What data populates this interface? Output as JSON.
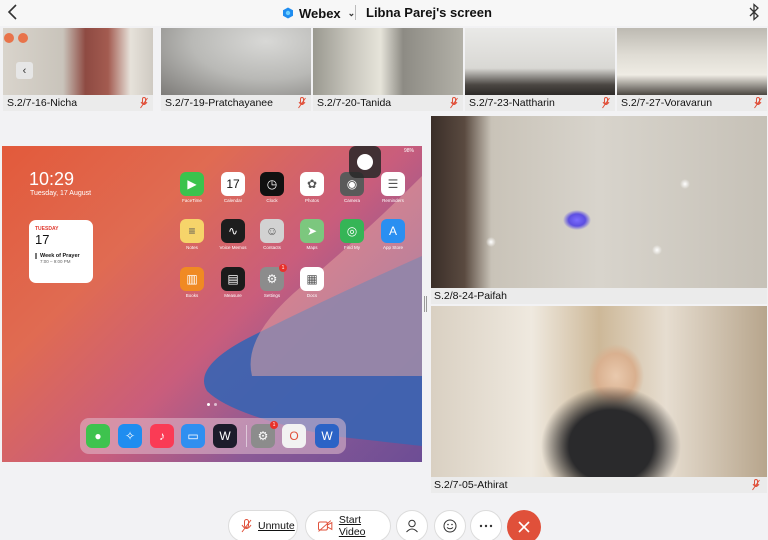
{
  "header": {
    "app_name": "Webex",
    "screen_title": "Libna Parej's screen"
  },
  "thumbnails": [
    {
      "name": "S.2/7-16-Nicha",
      "muted": true
    },
    {
      "name": "S.2/7-19-Pratchayanee",
      "muted": true
    },
    {
      "name": "S.2/7-20-Tanida",
      "muted": true
    },
    {
      "name": "S.2/7-23-Nattharin",
      "muted": true
    },
    {
      "name": "S.2/7-27-Voravarun",
      "muted": true
    }
  ],
  "shared_screen": {
    "time": "10:29",
    "date": "Tuesday, 17 August",
    "status": "98%",
    "widget": {
      "day": "TUESDAY",
      "num": "17",
      "event": "Week of Prayer",
      "event_time": "7:00 – 9:00 PM"
    },
    "apps": [
      {
        "label": "FaceTime",
        "color": "#3ac34d",
        "glyph": "▶"
      },
      {
        "label": "Calendar",
        "color": "#ffffff",
        "glyph": "17",
        "sub": "TUE"
      },
      {
        "label": "Clock",
        "color": "#111111",
        "glyph": "◷"
      },
      {
        "label": "Photos",
        "color": "#ffffff",
        "glyph": "✿"
      },
      {
        "label": "Camera",
        "color": "#5a5a5a",
        "glyph": "◉"
      },
      {
        "label": "Reminders",
        "color": "#ffffff",
        "glyph": "☰"
      },
      {
        "label": "Notes",
        "color": "#f6d46a",
        "glyph": "≡"
      },
      {
        "label": "Voice Memos",
        "color": "#1d1d1d",
        "glyph": "∿"
      },
      {
        "label": "Contacts",
        "color": "#d2d2d2",
        "glyph": "☺"
      },
      {
        "label": "Maps",
        "color": "#7cc77e",
        "glyph": "➤"
      },
      {
        "label": "Find My",
        "color": "#35b556",
        "glyph": "◎"
      },
      {
        "label": "App Store",
        "color": "#2a8ff1",
        "glyph": "A"
      },
      {
        "label": "Books",
        "color": "#f08a23",
        "glyph": "▥"
      },
      {
        "label": "Measure",
        "color": "#1b1b1b",
        "glyph": "▤"
      },
      {
        "label": "Settings",
        "color": "#8c8c8c",
        "glyph": "⚙",
        "badge": "1"
      },
      {
        "label": "Docs",
        "color": "#ffffff",
        "glyph": "▦"
      }
    ],
    "dock": [
      {
        "name": "messages",
        "color": "#3ec34e",
        "glyph": "●"
      },
      {
        "name": "safari",
        "color": "#1f8df0",
        "glyph": "✧"
      },
      {
        "name": "music",
        "color": "#fa3b55",
        "glyph": "♪"
      },
      {
        "name": "files",
        "color": "#2f8ff0",
        "glyph": "▭"
      },
      {
        "name": "webex",
        "color": "#1c1c2b",
        "glyph": "W"
      },
      {
        "name": "settings",
        "color": "#8c8c8c",
        "glyph": "⚙",
        "badge": "1"
      },
      {
        "name": "office",
        "color": "#f2f2f2",
        "glyph": "O"
      },
      {
        "name": "word",
        "color": "#2b63c6",
        "glyph": "W"
      }
    ]
  },
  "tiles": [
    {
      "name": "S.2/8-24-Paifah",
      "muted": false
    },
    {
      "name": "S.2/7-05-Athirat",
      "muted": true
    }
  ],
  "controls": {
    "unmute_label": "Unmute",
    "start_video_label": "Start Video"
  },
  "colors": {
    "muted_mic": "#e0503a",
    "end_call": "#e0503a",
    "webex_blue": "#1f8df0"
  }
}
